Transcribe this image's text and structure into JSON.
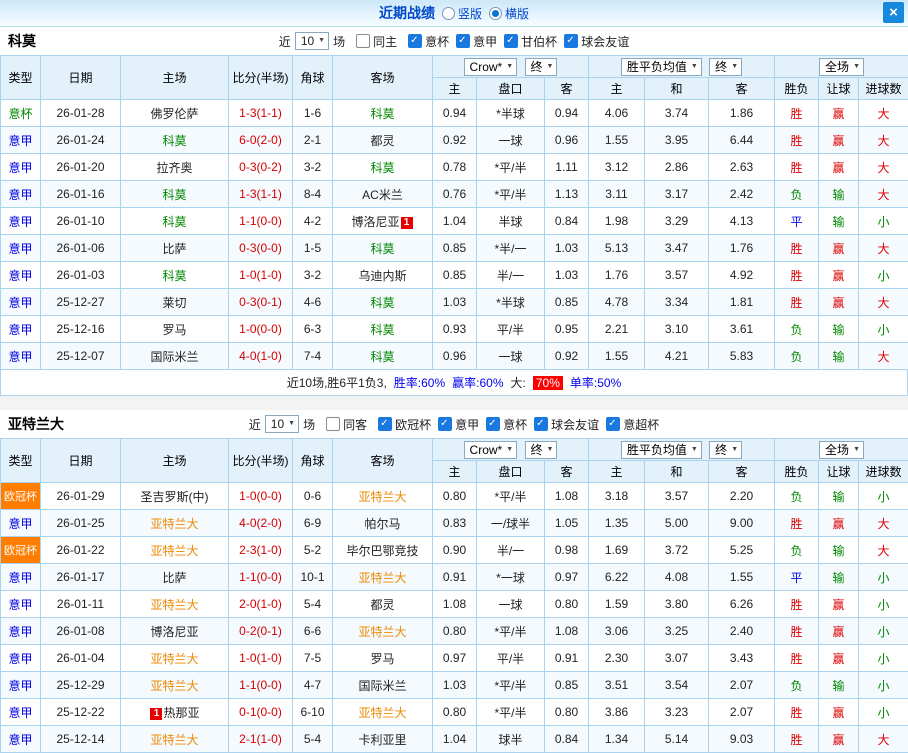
{
  "topbar": {
    "title": "近期战绩",
    "radios": [
      {
        "label": "竖版",
        "checked": false
      },
      {
        "label": "横版",
        "checked": true
      }
    ],
    "close_label": "×"
  },
  "dropdowns": {
    "company": "Crow*",
    "time1": "终",
    "euro": "胜平负均值",
    "time2": "终",
    "scope": "全场"
  },
  "table_header": {
    "type": "类型",
    "date": "日期",
    "home": "主场",
    "score": "比分(半场)",
    "corner": "角球",
    "away": "客场",
    "asian_home": "主",
    "asian_handicap": "盘口",
    "asian_away": "客",
    "euro_home": "主",
    "euro_draw": "和",
    "euro_away": "客",
    "result": "胜负",
    "handicap_result": "让球",
    "goals": "进球数"
  },
  "sections": [
    {
      "team": "科莫",
      "near_label": "近",
      "games_count": "10",
      "games_label": "场",
      "same_checkbox": "同主",
      "filters": [
        "意杯",
        "意甲",
        "甘伯杯",
        "球会友谊"
      ],
      "rows": [
        {
          "type": "意杯",
          "date": "26-01-28",
          "home": "佛罗伦萨",
          "score": "1-3(1-1)",
          "corner": "1-6",
          "away": "科莫",
          "asian_home": "0.94",
          "handicap": "*半球",
          "asian_away": "0.94",
          "euro_home": "4.06",
          "euro_draw": "3.74",
          "euro_away": "1.86",
          "result": "胜",
          "handicap_result": "赢",
          "goals": "大"
        },
        {
          "type": "意甲",
          "date": "26-01-24",
          "home": "科莫",
          "score": "6-0(2-0)",
          "corner": "2-1",
          "away": "都灵",
          "asian_home": "0.92",
          "handicap": "一球",
          "asian_away": "0.96",
          "euro_home": "1.55",
          "euro_draw": "3.95",
          "euro_away": "6.44",
          "result": "胜",
          "handicap_result": "赢",
          "goals": "大"
        },
        {
          "type": "意甲",
          "date": "26-01-20",
          "home": "拉齐奥",
          "score": "0-3(0-2)",
          "corner": "3-2",
          "away": "科莫",
          "asian_home": "0.78",
          "handicap": "*平/半",
          "asian_away": "1.11",
          "euro_home": "3.12",
          "euro_draw": "2.86",
          "euro_away": "2.63",
          "result": "胜",
          "handicap_result": "赢",
          "goals": "大"
        },
        {
          "type": "意甲",
          "date": "26-01-16",
          "home": "科莫",
          "score": "1-3(1-1)",
          "corner": "8-4",
          "away": "AC米兰",
          "asian_home": "0.76",
          "handicap": "*平/半",
          "asian_away": "1.13",
          "euro_home": "3.11",
          "euro_draw": "3.17",
          "euro_away": "2.42",
          "result": "负",
          "handicap_result": "输",
          "goals": "大"
        },
        {
          "type": "意甲",
          "date": "26-01-10",
          "home": "科莫",
          "score": "1-1(0-0)",
          "corner": "4-2",
          "away": "博洛尼亚",
          "away_red": "1",
          "asian_home": "1.04",
          "handicap": "半球",
          "asian_away": "0.84",
          "euro_home": "1.98",
          "euro_draw": "3.29",
          "euro_away": "4.13",
          "result": "平",
          "handicap_result": "输",
          "goals": "小"
        },
        {
          "type": "意甲",
          "date": "26-01-06",
          "home": "比萨",
          "score": "0-3(0-0)",
          "corner": "1-5",
          "away": "科莫",
          "asian_home": "0.85",
          "handicap": "*半/一",
          "asian_away": "1.03",
          "euro_home": "5.13",
          "euro_draw": "3.47",
          "euro_away": "1.76",
          "result": "胜",
          "handicap_result": "赢",
          "goals": "大"
        },
        {
          "type": "意甲",
          "date": "26-01-03",
          "home": "科莫",
          "score": "1-0(1-0)",
          "corner": "3-2",
          "away": "乌迪内斯",
          "asian_home": "0.85",
          "handicap": "半/一",
          "asian_away": "1.03",
          "euro_home": "1.76",
          "euro_draw": "3.57",
          "euro_away": "4.92",
          "result": "胜",
          "handicap_result": "赢",
          "goals": "小"
        },
        {
          "type": "意甲",
          "date": "25-12-27",
          "home": "莱切",
          "score": "0-3(0-1)",
          "corner": "4-6",
          "away": "科莫",
          "asian_home": "1.03",
          "handicap": "*半球",
          "asian_away": "0.85",
          "euro_home": "4.78",
          "euro_draw": "3.34",
          "euro_away": "1.81",
          "result": "胜",
          "handicap_result": "赢",
          "goals": "大"
        },
        {
          "type": "意甲",
          "date": "25-12-16",
          "home": "罗马",
          "score": "1-0(0-0)",
          "corner": "6-3",
          "away": "科莫",
          "asian_home": "0.93",
          "handicap": "平/半",
          "asian_away": "0.95",
          "euro_home": "2.21",
          "euro_draw": "3.10",
          "euro_away": "3.61",
          "result": "负",
          "handicap_result": "输",
          "goals": "小"
        },
        {
          "type": "意甲",
          "date": "25-12-07",
          "home": "国际米兰",
          "score": "4-0(1-0)",
          "corner": "7-4",
          "away": "科莫",
          "asian_home": "0.96",
          "handicap": "一球",
          "asian_away": "0.92",
          "euro_home": "1.55",
          "euro_draw": "4.21",
          "euro_away": "5.83",
          "result": "负",
          "handicap_result": "输",
          "goals": "大"
        }
      ],
      "summary": {
        "prefix": "近10场,胜6平1负3,",
        "win_rate": "胜率:60%",
        "handicap_rate": "赢率:60%",
        "big_label": "大:",
        "big_value": "70%",
        "single_rate": "单率:50%"
      }
    },
    {
      "team": "亚特兰大",
      "near_label": "近",
      "games_count": "10",
      "games_label": "场",
      "same_checkbox": "同客",
      "filters": [
        "欧冠杯",
        "意甲",
        "意杯",
        "球会友谊",
        "意超杯"
      ],
      "rows": [
        {
          "type": "欧冠杯",
          "date": "26-01-29",
          "home": "圣吉罗斯(中)",
          "score": "1-0(0-0)",
          "corner": "0-6",
          "away": "亚特兰大",
          "asian_home": "0.80",
          "handicap": "*平/半",
          "asian_away": "1.08",
          "euro_home": "3.18",
          "euro_draw": "3.57",
          "euro_away": "2.20",
          "result": "负",
          "handicap_result": "输",
          "goals": "小"
        },
        {
          "type": "意甲",
          "date": "26-01-25",
          "home": "亚特兰大",
          "score": "4-0(2-0)",
          "corner": "6-9",
          "away": "帕尔马",
          "asian_home": "0.83",
          "handicap": "一/球半",
          "asian_away": "1.05",
          "euro_home": "1.35",
          "euro_draw": "5.00",
          "euro_away": "9.00",
          "result": "胜",
          "handicap_result": "赢",
          "goals": "大"
        },
        {
          "type": "欧冠杯",
          "date": "26-01-22",
          "home": "亚特兰大",
          "score": "2-3(1-0)",
          "corner": "5-2",
          "away": "毕尔巴鄂竞技",
          "asian_home": "0.90",
          "handicap": "半/一",
          "asian_away": "0.98",
          "euro_home": "1.69",
          "euro_draw": "3.72",
          "euro_away": "5.25",
          "result": "负",
          "handicap_result": "输",
          "goals": "大"
        },
        {
          "type": "意甲",
          "date": "26-01-17",
          "home": "比萨",
          "score": "1-1(0-0)",
          "corner": "10-1",
          "away": "亚特兰大",
          "asian_home": "0.91",
          "handicap": "*一球",
          "asian_away": "0.97",
          "euro_home": "6.22",
          "euro_draw": "4.08",
          "euro_away": "1.55",
          "result": "平",
          "handicap_result": "输",
          "goals": "小"
        },
        {
          "type": "意甲",
          "date": "26-01-11",
          "home": "亚特兰大",
          "score": "2-0(1-0)",
          "corner": "5-4",
          "away": "都灵",
          "asian_home": "1.08",
          "handicap": "一球",
          "asian_away": "0.80",
          "euro_home": "1.59",
          "euro_draw": "3.80",
          "euro_away": "6.26",
          "result": "胜",
          "handicap_result": "赢",
          "goals": "小"
        },
        {
          "type": "意甲",
          "date": "26-01-08",
          "home": "博洛尼亚",
          "score": "0-2(0-1)",
          "corner": "6-6",
          "away": "亚特兰大",
          "asian_home": "0.80",
          "handicap": "*平/半",
          "asian_away": "1.08",
          "euro_home": "3.06",
          "euro_draw": "3.25",
          "euro_away": "2.40",
          "result": "胜",
          "handicap_result": "赢",
          "goals": "小"
        },
        {
          "type": "意甲",
          "date": "26-01-04",
          "home": "亚特兰大",
          "score": "1-0(1-0)",
          "corner": "7-5",
          "away": "罗马",
          "asian_home": "0.97",
          "handicap": "平/半",
          "asian_away": "0.91",
          "euro_home": "2.30",
          "euro_draw": "3.07",
          "euro_away": "3.43",
          "result": "胜",
          "handicap_result": "赢",
          "goals": "小"
        },
        {
          "type": "意甲",
          "date": "25-12-29",
          "home": "亚特兰大",
          "score": "1-1(0-0)",
          "corner": "4-7",
          "away": "国际米兰",
          "asian_home": "1.03",
          "handicap": "*平/半",
          "asian_away": "0.85",
          "euro_home": "3.51",
          "euro_draw": "3.54",
          "euro_away": "2.07",
          "result": "负",
          "handicap_result": "输",
          "goals": "小"
        },
        {
          "type": "意甲",
          "date": "25-12-22",
          "home": "热那亚",
          "home_red": "1",
          "score": "0-1(0-0)",
          "corner": "6-10",
          "away": "亚特兰大",
          "asian_home": "0.80",
          "handicap": "*平/半",
          "asian_away": "0.80",
          "euro_home": "3.86",
          "euro_draw": "3.23",
          "euro_away": "2.07",
          "result": "胜",
          "handicap_result": "赢",
          "goals": "小"
        },
        {
          "type": "意甲",
          "date": "25-12-14",
          "home": "亚特兰大",
          "score": "2-1(1-0)",
          "corner": "5-4",
          "away": "卡利亚里",
          "asian_home": "1.04",
          "handicap": "球半",
          "asian_away": "0.84",
          "euro_home": "1.34",
          "euro_draw": "5.14",
          "euro_away": "9.03",
          "result": "胜",
          "handicap_result": "赢",
          "goals": "大"
        }
      ]
    }
  ]
}
